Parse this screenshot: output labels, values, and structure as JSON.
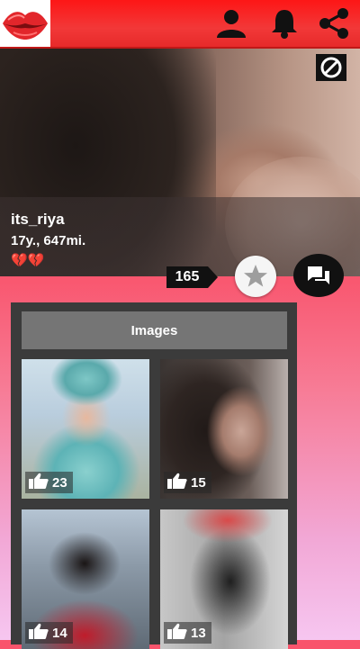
{
  "topbar": {
    "icons": [
      "lips-logo",
      "profile-icon",
      "notification-bell-icon",
      "share-icon"
    ]
  },
  "profile": {
    "username": "its_riya",
    "age_distance": "17y., 647mi.",
    "hearts": "💔💔",
    "favorite_count": "165"
  },
  "actions": {
    "icons": [
      "block-icon",
      "star-icon",
      "chat-icon"
    ]
  },
  "gallery": {
    "tab_label": "Images",
    "images": [
      {
        "likes": "23"
      },
      {
        "likes": "15"
      },
      {
        "likes": "14"
      },
      {
        "likes": "13"
      }
    ]
  },
  "colors": {
    "topbar": "#fd1616",
    "background_top": "#f9546c",
    "background_bottom": "#f6c6f0",
    "panel": "#3b3b3b",
    "tab": "#757575"
  }
}
